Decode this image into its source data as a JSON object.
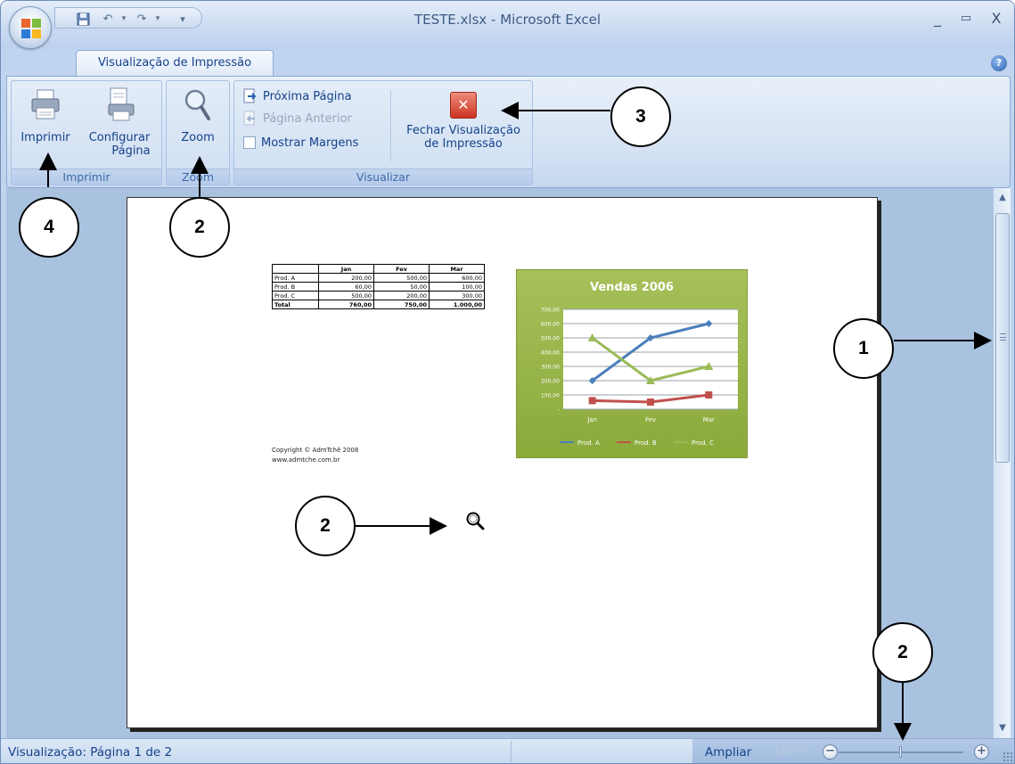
{
  "window": {
    "title": "TESTE.xlsx - Microsoft Excel",
    "minimize": "_",
    "maximize": "▭",
    "close": "X"
  },
  "tabs": [
    {
      "label": "Visualização de Impressão",
      "active": true
    }
  ],
  "help_label": "?",
  "ribbon": {
    "groups": {
      "imprimir": {
        "label": "Imprimir",
        "buttons": {
          "imprimir": "Imprimir",
          "configurar_line1": "Configurar",
          "configurar_line2": "Página"
        }
      },
      "zoom": {
        "label": "Zoom",
        "buttons": {
          "zoom": "Zoom"
        }
      },
      "visualizar": {
        "label": "Visualizar",
        "buttons": {
          "proxima": "Próxima Página",
          "anterior": "Página Anterior",
          "mostrar_margens": "Mostrar Margens",
          "fechar_line1": "Fechar Visualização",
          "fechar_line2": "de Impressão"
        }
      }
    }
  },
  "preview": {
    "table": {
      "headers": [
        "",
        "Jan",
        "Fev",
        "Mar"
      ],
      "rows": [
        [
          "Prod. A",
          "200,00",
          "500,00",
          "600,00"
        ],
        [
          "Prod. B",
          "60,00",
          "50,00",
          "100,00"
        ],
        [
          "Prod. C",
          "500,00",
          "200,00",
          "300,00"
        ],
        [
          "Total",
          "760,00",
          "750,00",
          "1.000,00"
        ]
      ]
    },
    "copyright": [
      "Copyright © AdmTchê 2008",
      "www.admtche.com.br"
    ]
  },
  "chart_data": {
    "type": "line",
    "title": "Vendas 2006",
    "categories": [
      "Jan",
      "Fev",
      "Mar"
    ],
    "series": [
      {
        "name": "Prod. A",
        "values": [
          200,
          500,
          600
        ],
        "color": "#4a7ebb"
      },
      {
        "name": "Prod. B",
        "values": [
          60,
          50,
          100
        ],
        "color": "#c0504d"
      },
      {
        "name": "Prod. C",
        "values": [
          500,
          200,
          300
        ],
        "color": "#9bbb59"
      }
    ],
    "ylim": [
      0,
      700
    ],
    "yticks": [
      "700,00",
      "600,00",
      "500,00",
      "400,00",
      "300,00",
      "200,00",
      "100,00",
      "-"
    ],
    "legend": "bottom",
    "grid": true
  },
  "status": {
    "page_info": "Visualização: Página 1 de 2",
    "zoom_label": "Ampliar",
    "zoom_value": "100%"
  },
  "annotations": [
    "1",
    "2",
    "2",
    "2",
    "3",
    "4"
  ]
}
